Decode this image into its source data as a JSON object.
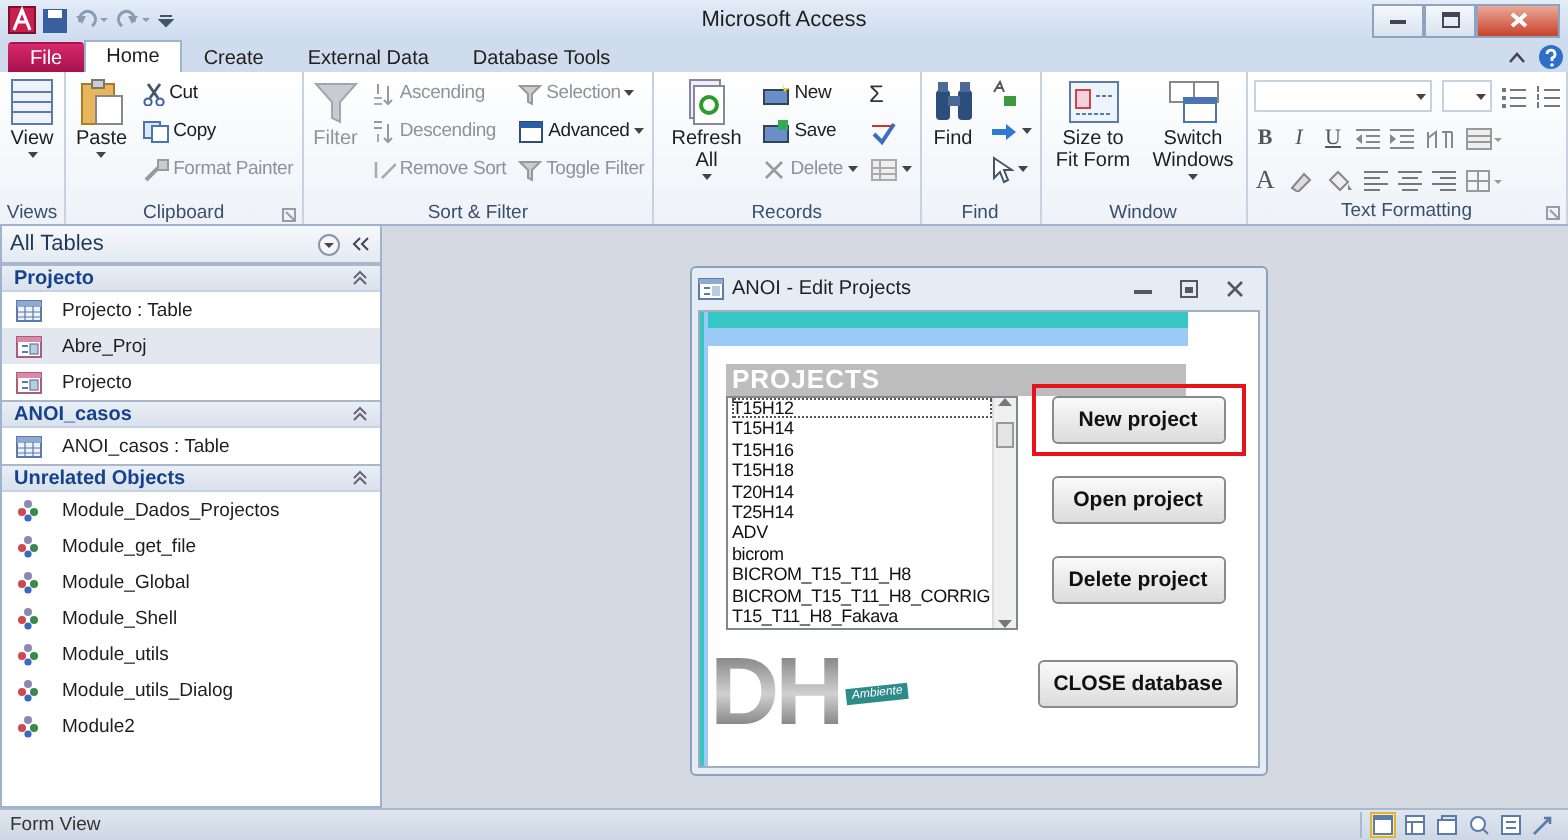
{
  "window": {
    "title": "Microsoft Access"
  },
  "tabs": [
    {
      "label": "File",
      "kind": "file",
      "selected": false
    },
    {
      "label": "Home",
      "kind": "tab",
      "selected": true
    },
    {
      "label": "Create",
      "kind": "tab",
      "selected": false
    },
    {
      "label": "External Data",
      "kind": "tab",
      "selected": false
    },
    {
      "label": "Database Tools",
      "kind": "tab",
      "selected": false
    }
  ],
  "ribbon": {
    "groups": [
      {
        "label": "Views",
        "columns": [
          [
            {
              "label": "View",
              "kind": "large",
              "dropdown": true,
              "disabled": false
            }
          ]
        ]
      },
      {
        "label": "Clipboard",
        "launcher": true,
        "columns": [
          [
            {
              "label": "Paste",
              "kind": "large",
              "dropdown": true,
              "disabled": false
            }
          ],
          [
            {
              "label": "Cut",
              "kind": "small",
              "disabled": false
            },
            {
              "label": "Copy",
              "kind": "small",
              "disabled": false
            },
            {
              "label": "Format Painter",
              "kind": "small",
              "disabled": true
            }
          ]
        ]
      },
      {
        "label": "Sort & Filter",
        "columns": [
          [
            {
              "label": "Filter",
              "kind": "large",
              "disabled": true
            }
          ],
          [
            {
              "label": "Ascending",
              "kind": "small",
              "disabled": true
            },
            {
              "label": "Descending",
              "kind": "small",
              "disabled": true
            },
            {
              "label": "Remove Sort",
              "kind": "small",
              "disabled": true
            }
          ],
          [
            {
              "label": "Selection",
              "kind": "small",
              "dropdown": true,
              "disabled": true
            },
            {
              "label": "Advanced",
              "kind": "small",
              "dropdown": true,
              "disabled": false
            },
            {
              "label": "Toggle Filter",
              "kind": "small",
              "disabled": true
            }
          ]
        ]
      },
      {
        "label": "Records",
        "columns": [
          [
            {
              "label": "Refresh All",
              "kind": "large",
              "dropdown": true,
              "disabled": false
            }
          ],
          [
            {
              "label": "New",
              "kind": "small",
              "disabled": false
            },
            {
              "label": "Save",
              "kind": "small",
              "disabled": false
            },
            {
              "label": "Delete",
              "kind": "small",
              "dropdown": true,
              "disabled": true
            }
          ],
          [
            {
              "label": "Σ",
              "kind": "glyph",
              "disabled": false
            },
            {
              "kind": "small",
              "disabled": false
            },
            {
              "kind": "small",
              "dropdown": true,
              "disabled": true
            }
          ]
        ]
      },
      {
        "label": "Find",
        "columns": [
          [
            {
              "label": "Find",
              "kind": "large",
              "disabled": false
            }
          ],
          [
            {
              "kind": "small",
              "disabled": false
            },
            {
              "kind": "small",
              "dropdown": true,
              "disabled": false
            },
            {
              "kind": "small",
              "dropdown": true,
              "disabled": false
            }
          ]
        ]
      },
      {
        "label": "Window",
        "columns": [
          [
            {
              "label": "Size to Fit Form",
              "kind": "large",
              "disabled": false
            }
          ],
          [
            {
              "label": "Switch Windows",
              "kind": "large",
              "dropdown": true,
              "disabled": false
            }
          ]
        ]
      },
      {
        "label": "Text Formatting",
        "launcher": true,
        "kind": "format",
        "glyphs": [
          "B",
          "I",
          "U",
          "A"
        ]
      }
    ]
  },
  "navigation": {
    "title": "All Tables",
    "groups": [
      {
        "label": "Projecto",
        "items": [
          {
            "label": "Projecto : Table",
            "kind": "table",
            "selected": false
          },
          {
            "label": "Abre_Proj",
            "kind": "form",
            "selected": true
          },
          {
            "label": "Projecto",
            "kind": "form",
            "selected": false
          }
        ]
      },
      {
        "label": "ANOI_casos",
        "items": [
          {
            "label": "ANOI_casos : Table",
            "kind": "table",
            "selected": false
          }
        ]
      },
      {
        "label": "Unrelated Objects",
        "items": [
          {
            "label": "Module_Dados_Projectos",
            "kind": "module",
            "selected": false
          },
          {
            "label": "Module_get_file",
            "kind": "module",
            "selected": false
          },
          {
            "label": "Module_Global",
            "kind": "module",
            "selected": false
          },
          {
            "label": "Module_Shell",
            "kind": "module",
            "selected": false
          },
          {
            "label": "Module_utils",
            "kind": "module",
            "selected": false
          },
          {
            "label": "Module_utils_Dialog",
            "kind": "module",
            "selected": false
          },
          {
            "label": "Module2",
            "kind": "module",
            "selected": false
          }
        ]
      }
    ]
  },
  "dialog": {
    "title": "ANOI - Edit Projects",
    "header": "PROJECTS",
    "projects": [
      {
        "label": "T15H12",
        "selected": true
      },
      {
        "label": "T15H14",
        "selected": false
      },
      {
        "label": "T15H16",
        "selected": false
      },
      {
        "label": "T15H18",
        "selected": false
      },
      {
        "label": "T20H14",
        "selected": false
      },
      {
        "label": "T25H14",
        "selected": false
      },
      {
        "label": "ADV",
        "selected": false
      },
      {
        "label": "bicrom",
        "selected": false
      },
      {
        "label": "BICROM_T15_T11_H8",
        "selected": false
      },
      {
        "label": "BICROM_T15_T11_H8_CORRIG",
        "selected": false
      },
      {
        "label": "T15_T11_H8_Fakava",
        "selected": false
      }
    ],
    "buttons": [
      {
        "label": "New project",
        "highlighted": true
      },
      {
        "label": "Open project",
        "highlighted": false
      },
      {
        "label": "Delete project",
        "highlighted": false
      },
      {
        "label": "CLOSE database",
        "highlighted": false
      }
    ],
    "logo": {
      "letters": "DH",
      "banner": "Ambiente"
    }
  },
  "status_bar": {
    "text": "Form View",
    "views": [
      {
        "selected": true
      },
      {
        "selected": false
      },
      {
        "selected": false
      },
      {
        "selected": false
      },
      {
        "selected": false
      },
      {
        "selected": false
      }
    ]
  }
}
